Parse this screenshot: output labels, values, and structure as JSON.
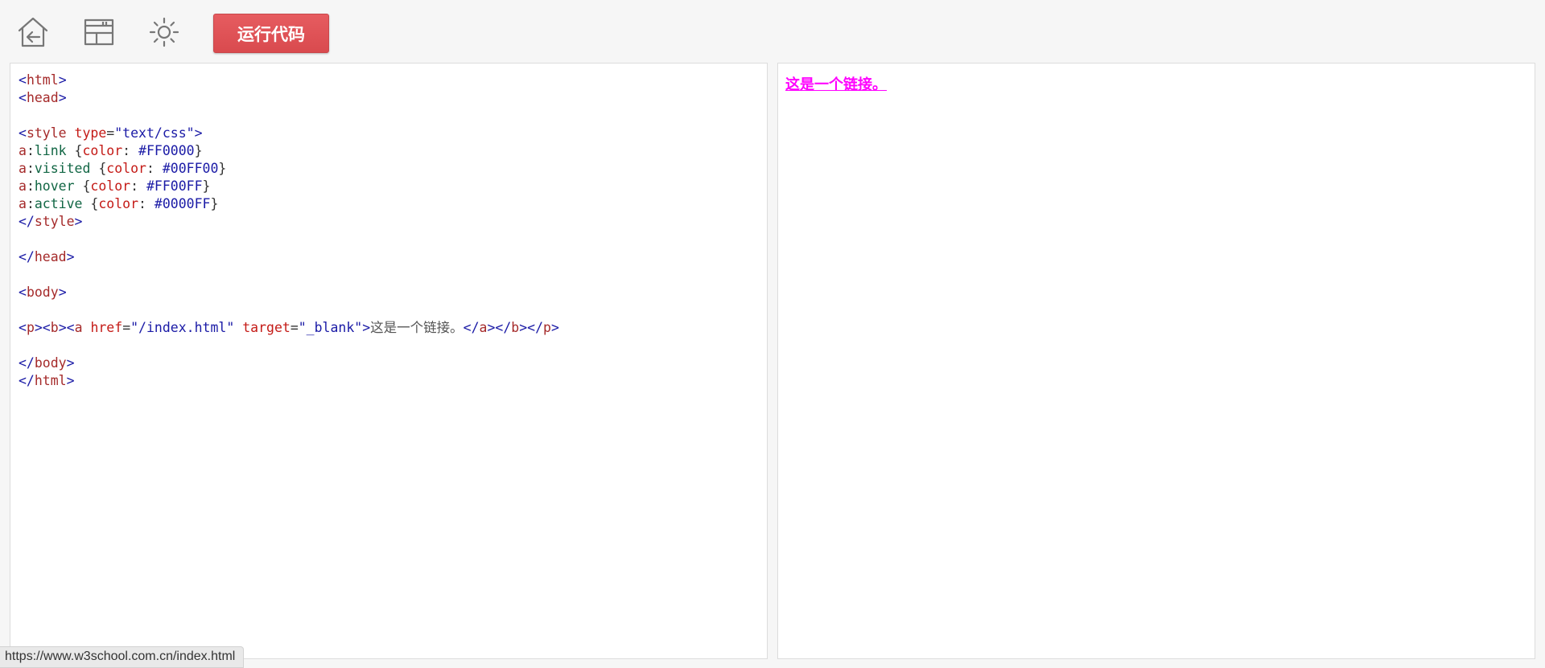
{
  "toolbar": {
    "icons": [
      "home-back-icon",
      "layout-icon",
      "brightness-icon"
    ],
    "run_label": "运行代码"
  },
  "editor": {
    "lines": [
      {
        "parts": [
          [
            "tb",
            "<"
          ],
          [
            "tn",
            "html"
          ],
          [
            "tb",
            ">"
          ]
        ]
      },
      {
        "parts": [
          [
            "tb",
            "<"
          ],
          [
            "tn",
            "head"
          ],
          [
            "tb",
            ">"
          ]
        ]
      },
      {
        "parts": []
      },
      {
        "parts": [
          [
            "tb",
            "<"
          ],
          [
            "tn",
            "style"
          ],
          [
            "cb",
            " "
          ],
          [
            "an",
            "type"
          ],
          [
            "cb",
            "="
          ],
          [
            "av",
            "\"text/css\""
          ],
          [
            "tb",
            ">"
          ]
        ]
      },
      {
        "parts": [
          [
            "cs",
            "a"
          ],
          [
            "cb",
            ":"
          ],
          [
            "cp",
            "link"
          ],
          [
            "cb",
            " {"
          ],
          [
            "ck",
            "color"
          ],
          [
            "cb",
            ": "
          ],
          [
            "cv",
            "#FF0000"
          ],
          [
            "cb",
            "}"
          ]
        ]
      },
      {
        "parts": [
          [
            "cs",
            "a"
          ],
          [
            "cb",
            ":"
          ],
          [
            "cp",
            "visited"
          ],
          [
            "cb",
            " {"
          ],
          [
            "ck",
            "color"
          ],
          [
            "cb",
            ": "
          ],
          [
            "cv",
            "#00FF00"
          ],
          [
            "cb",
            "}"
          ]
        ]
      },
      {
        "parts": [
          [
            "cs",
            "a"
          ],
          [
            "cb",
            ":"
          ],
          [
            "cp",
            "hover"
          ],
          [
            "cb",
            " {"
          ],
          [
            "ck",
            "color"
          ],
          [
            "cb",
            ": "
          ],
          [
            "cv",
            "#FF00FF"
          ],
          [
            "cb",
            "}"
          ]
        ]
      },
      {
        "parts": [
          [
            "cs",
            "a"
          ],
          [
            "cb",
            ":"
          ],
          [
            "cp",
            "active"
          ],
          [
            "cb",
            " {"
          ],
          [
            "ck",
            "color"
          ],
          [
            "cb",
            ": "
          ],
          [
            "cv",
            "#0000FF"
          ],
          [
            "cb",
            "}"
          ]
        ]
      },
      {
        "parts": [
          [
            "tb",
            "</"
          ],
          [
            "tn",
            "style"
          ],
          [
            "tb",
            ">"
          ]
        ]
      },
      {
        "parts": []
      },
      {
        "parts": [
          [
            "tb",
            "</"
          ],
          [
            "tn",
            "head"
          ],
          [
            "tb",
            ">"
          ]
        ]
      },
      {
        "parts": []
      },
      {
        "parts": [
          [
            "tb",
            "<"
          ],
          [
            "tn",
            "body"
          ],
          [
            "tb",
            ">"
          ]
        ]
      },
      {
        "parts": []
      },
      {
        "parts": [
          [
            "tb",
            "<"
          ],
          [
            "tn",
            "p"
          ],
          [
            "tb",
            "><"
          ],
          [
            "tn",
            "b"
          ],
          [
            "tb",
            "><"
          ],
          [
            "tn",
            "a"
          ],
          [
            "cb",
            " "
          ],
          [
            "an",
            "href"
          ],
          [
            "cb",
            "="
          ],
          [
            "av",
            "\"/index.html\""
          ],
          [
            "cb",
            " "
          ],
          [
            "an",
            "target"
          ],
          [
            "cb",
            "="
          ],
          [
            "av",
            "\"_blank\""
          ],
          [
            "tb",
            ">"
          ],
          [
            "tx",
            "这是一个链接。"
          ],
          [
            "tb",
            "</"
          ],
          [
            "tn",
            "a"
          ],
          [
            "tb",
            "></"
          ],
          [
            "tn",
            "b"
          ],
          [
            "tb",
            "></"
          ],
          [
            "tn",
            "p"
          ],
          [
            "tb",
            ">"
          ]
        ]
      },
      {
        "parts": []
      },
      {
        "parts": [
          [
            "tb",
            "</"
          ],
          [
            "tn",
            "body"
          ],
          [
            "tb",
            ">"
          ]
        ]
      },
      {
        "parts": [
          [
            "tb",
            "</"
          ],
          [
            "tn",
            "html"
          ],
          [
            "tb",
            ">"
          ]
        ]
      }
    ]
  },
  "result": {
    "link_text": "这是一个链接。",
    "link_color": "#FF00FF"
  },
  "status_bar": {
    "url": "https://www.w3school.com.cn/index.html"
  },
  "colors": {
    "run_button": "#E05357",
    "toolbar_bg": "#F6F6F6"
  }
}
